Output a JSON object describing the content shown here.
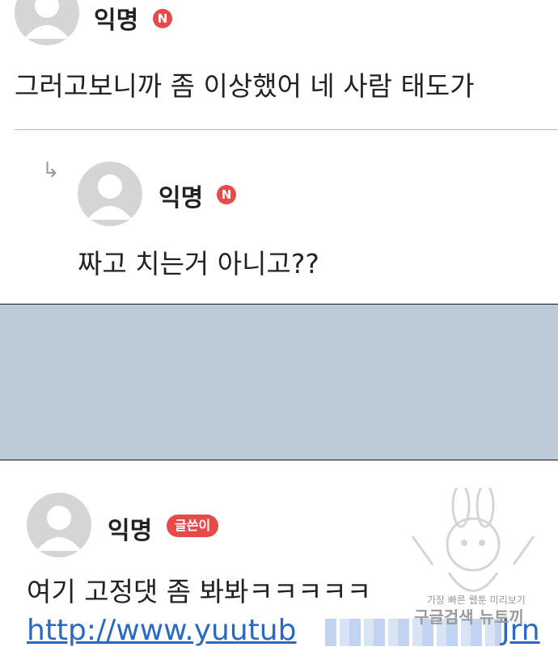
{
  "comments": [
    {
      "author": "익명",
      "badge": "N",
      "text": "그러고보니까 좀 이상했어 네 사람 태도가"
    },
    {
      "author": "익명",
      "badge": "N",
      "reply_marker": "↳",
      "text": "짜고 치는거 아니고??"
    },
    {
      "author": "익명",
      "badge": "글쓴이",
      "text": "여기 고정댓 좀 봐봐ㅋㅋㅋㅋㅋ",
      "link_start": "http://www.yuutub",
      "link_end": "Jrn"
    }
  ],
  "watermark": {
    "line1": "가장 빠른 웹툰 미리보기",
    "line2": "구글검색 뉴토끼"
  },
  "colors": {
    "badge": "#e84a4a",
    "link": "#2b68c4",
    "gap_panel": "#bdcad8"
  }
}
